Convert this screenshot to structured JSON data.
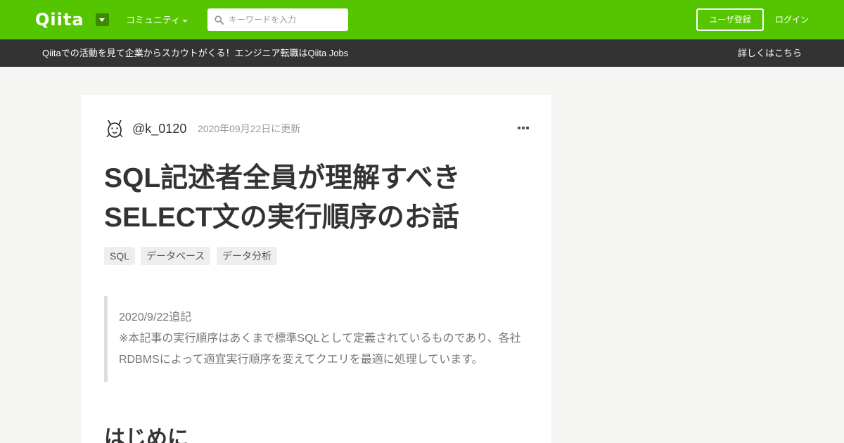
{
  "header": {
    "logo": "Qiita",
    "community_label": "コミュニティ",
    "search_placeholder": "キーワードを入力",
    "signup_label": "ユーザ登録",
    "login_label": "ログイン"
  },
  "banner": {
    "text": "Qiitaでの活動を見て企業からスカウトがくる！エンジニア転職はQiita Jobs",
    "link": "詳しくはこちら"
  },
  "article": {
    "author": "@k_0120",
    "updated": "2020年09月22日に更新",
    "title_lines": [
      "SQL記述者全員が理解すべき",
      "SELECT文の実行順序のお話"
    ],
    "tags": [
      "SQL",
      "データベース",
      "データ分析"
    ],
    "note_lines": [
      "2020/9/22追記",
      "※本記事の実行順序はあくまで標準SQLとして定義されているものであり、各社",
      "RDBMSによって適宜実行順序を変えてクエリを最適に処理しています。"
    ],
    "first_heading": "はじめに"
  },
  "colors": {
    "brand": "#55c500",
    "banner_bg": "#333333",
    "page_bg": "#f5f5f3"
  }
}
